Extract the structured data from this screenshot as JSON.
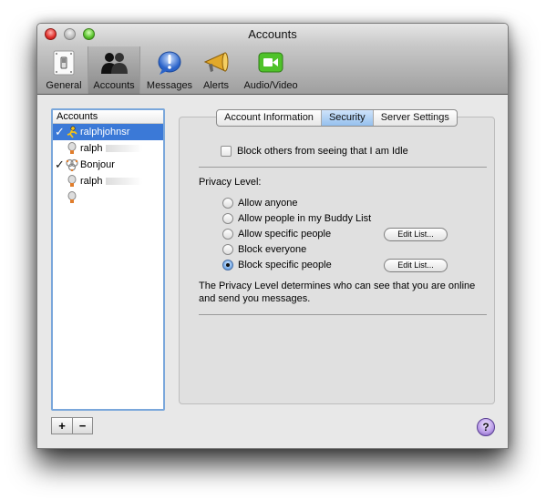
{
  "window": {
    "title": "Accounts"
  },
  "toolbar": {
    "items": [
      {
        "label": "General",
        "icon": "general-switch-icon",
        "selected": false
      },
      {
        "label": "Accounts",
        "icon": "accounts-people-icon",
        "selected": true
      },
      {
        "label": "Messages",
        "icon": "messages-bubble-icon",
        "selected": false
      },
      {
        "label": "Alerts",
        "icon": "alerts-megaphone-icon",
        "selected": false
      },
      {
        "label": "Audio/Video",
        "icon": "video-camera-icon",
        "selected": false
      }
    ]
  },
  "accounts_list": {
    "header": "Accounts",
    "items": [
      {
        "name": "ralphjohnsr",
        "enabled": true,
        "selected": true,
        "icon": "aim-runner-icon"
      },
      {
        "name": "ralph",
        "enabled": false,
        "selected": false,
        "icon": "jabber-bulb-icon"
      },
      {
        "name": "Bonjour",
        "enabled": true,
        "selected": false,
        "icon": "bonjour-icon"
      },
      {
        "name": "ralph",
        "enabled": false,
        "selected": false,
        "icon": "jabber-bulb-icon"
      },
      {
        "name": "",
        "enabled": false,
        "selected": false,
        "icon": "jabber-bulb-icon"
      }
    ],
    "add_label": "+",
    "remove_label": "−"
  },
  "tabs": [
    {
      "label": "Account Information",
      "active": false
    },
    {
      "label": "Security",
      "active": true
    },
    {
      "label": "Server Settings",
      "active": false
    }
  ],
  "security": {
    "block_idle_label": "Block others from seeing that I am Idle",
    "block_idle_checked": false,
    "privacy_label": "Privacy Level:",
    "options": [
      {
        "label": "Allow anyone",
        "selected": false
      },
      {
        "label": "Allow people in my Buddy List",
        "selected": false
      },
      {
        "label": "Allow specific people",
        "selected": false,
        "edit_button": "Edit List..."
      },
      {
        "label": "Block everyone",
        "selected": false
      },
      {
        "label": "Block specific people",
        "selected": true,
        "edit_button": "Edit List..."
      }
    ],
    "info_text": "The Privacy Level determines who can see that you are online and send you messages."
  },
  "help": {
    "label": "?"
  },
  "colors": {
    "selection": "#3b79d7",
    "list_border": "#7aa7db"
  }
}
